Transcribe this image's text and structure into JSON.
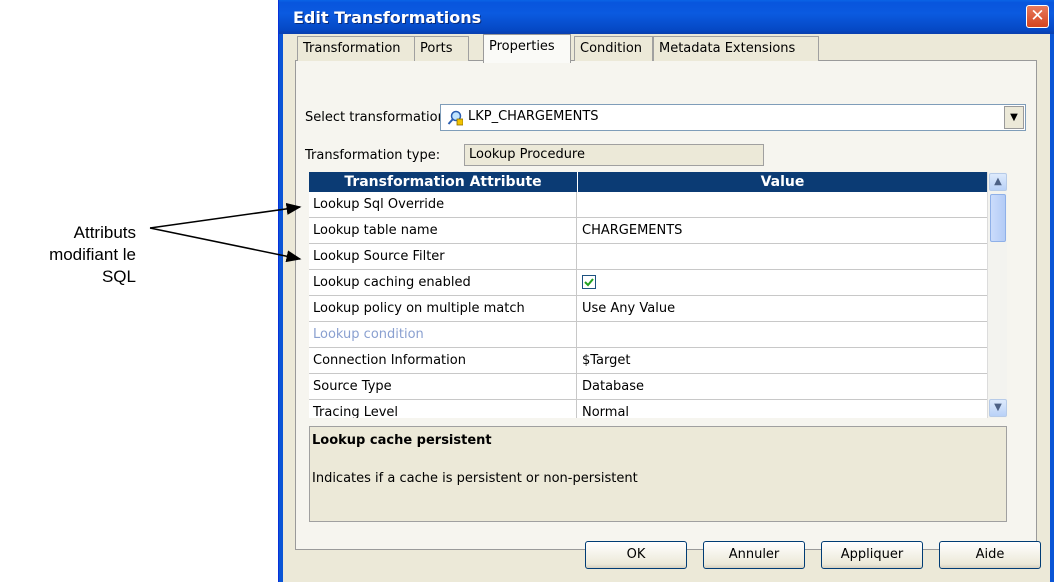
{
  "annotation": {
    "line1": "Attributs",
    "line2": "modifiant le",
    "line3": "SQL"
  },
  "window": {
    "title": "Edit Transformations",
    "close_symbol": "✕"
  },
  "tabs": [
    {
      "label": "Transformation",
      "active": false
    },
    {
      "label": "Ports",
      "active": false
    },
    {
      "label": "Properties",
      "active": true
    },
    {
      "label": "Condition",
      "active": false
    },
    {
      "label": "Metadata Extensions",
      "active": false
    }
  ],
  "select_transformation": {
    "label": "Select transformation:",
    "value": "LKP_CHARGEMENTS"
  },
  "transformation_type": {
    "label": "Transformation type:",
    "value": "Lookup Procedure"
  },
  "grid": {
    "headers": {
      "attribute": "Transformation Attribute",
      "value": "Value"
    },
    "rows": [
      {
        "attribute": "Lookup Sql Override",
        "value": ""
      },
      {
        "attribute": "Lookup table name",
        "value": "CHARGEMENTS"
      },
      {
        "attribute": "Lookup Source Filter",
        "value": ""
      },
      {
        "attribute": "Lookup caching enabled",
        "value": "",
        "checked": true
      },
      {
        "attribute": "Lookup policy on multiple match",
        "value": "Use Any Value"
      },
      {
        "attribute": "Lookup condition",
        "value": "",
        "disabled": true
      },
      {
        "attribute": "Connection Information",
        "value": "$Target"
      },
      {
        "attribute": "Source Type",
        "value": "Database"
      },
      {
        "attribute": "Tracing Level",
        "value": "Normal"
      }
    ]
  },
  "description": {
    "title": "Lookup cache persistent",
    "body": "Indicates if a cache is persistent or non-persistent"
  },
  "buttons": {
    "ok": "OK",
    "cancel": "Annuler",
    "apply": "Appliquer",
    "help": "Aide"
  },
  "colors": {
    "title_bar": "#0855dd",
    "grid_header": "#0b3b74",
    "dialog_bg": "#ece9d8",
    "close_button": "#d5441f"
  }
}
